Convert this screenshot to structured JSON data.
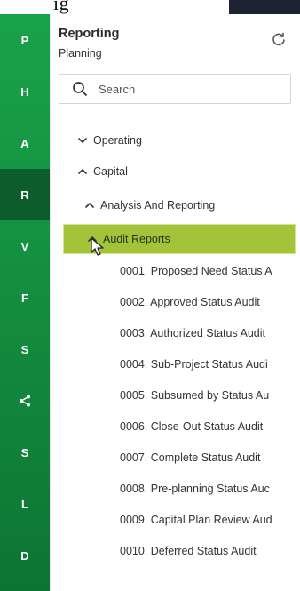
{
  "top_fragment": "ıg",
  "rail": {
    "items": [
      {
        "label": "P",
        "active": false
      },
      {
        "label": "H",
        "active": false
      },
      {
        "label": "A",
        "active": false
      },
      {
        "label": "R",
        "active": true
      },
      {
        "label": "V",
        "active": false
      },
      {
        "label": "F",
        "active": false
      },
      {
        "label": "S",
        "active": false
      },
      {
        "label": "",
        "icon": "share-icon",
        "active": false
      },
      {
        "label": "S",
        "active": false
      },
      {
        "label": "L",
        "active": false
      },
      {
        "label": "D",
        "active": false
      }
    ]
  },
  "panel": {
    "title": "Reporting",
    "subtitle": "Planning",
    "refresh_icon": "refresh-icon",
    "search": {
      "placeholder": "Search",
      "icon": "search-icon"
    }
  },
  "tree": {
    "operating": "Operating",
    "capital": "Capital",
    "analysis": "Analysis And Reporting",
    "audit_reports": "Audit Reports",
    "leaves": [
      "0001. Proposed Need Status A",
      "0002. Approved Status Audit",
      "0003. Authorized Status Audit",
      "0004. Sub-Project Status Audi",
      "0005. Subsumed by Status Au",
      "0006. Close-Out Status Audit",
      "0007. Complete Status Audit",
      "0008. Pre-planning Status Auc",
      "0009. Capital Plan Review Aud",
      "0010. Deferred Status Audit"
    ]
  },
  "colors": {
    "rail_green": "#19a24a",
    "rail_active": "#0d5d2c",
    "selected_bg": "#a3c43a"
  }
}
